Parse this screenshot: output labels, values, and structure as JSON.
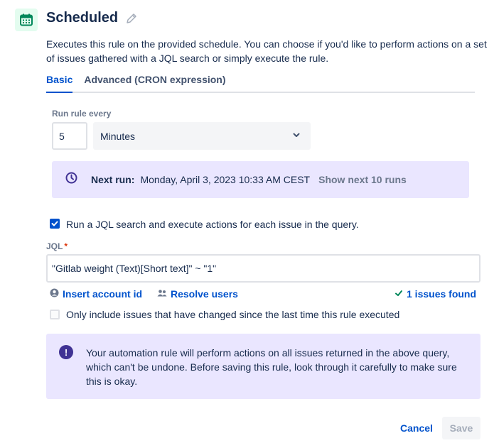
{
  "header": {
    "title": "Scheduled",
    "icon": "calendar-icon",
    "edit_icon": "pencil-icon",
    "icon_color": "#00875a"
  },
  "description": "Executes this rule on the provided schedule. You can choose if you'd like to perform actions on a set of issues gathered with a JQL search or simply execute the rule.",
  "tabs": [
    {
      "label": "Basic",
      "active": true
    },
    {
      "label": "Advanced (CRON expression)",
      "active": false
    }
  ],
  "schedule": {
    "run_every_label": "Run rule every",
    "interval_value": "5",
    "unit_selected": "Minutes",
    "next_run_label": "Next run:",
    "next_run_value": "Monday, April 3, 2023 10:33 AM CEST",
    "show_next_label": "Show next 10 runs"
  },
  "jql": {
    "checkbox_label": "Run a JQL search and execute actions for each issue in the query.",
    "checkbox_checked": true,
    "label": "JQL",
    "required_marker": "*",
    "value": "\"Gitlab weight (Text)[Short text]\" ~ \"1\"",
    "insert_account_label": "Insert account id",
    "resolve_users_label": "Resolve users",
    "issues_found_label": "1 issues found",
    "changed_checkbox_label": "Only include issues that have changed since the last time this rule executed",
    "changed_checkbox_checked": false
  },
  "info": {
    "text": "Your automation rule will perform actions on all issues returned in the above query, which can't be undone. Before saving this rule, look through it carefully to make sure this is okay."
  },
  "footer": {
    "cancel_label": "Cancel",
    "save_label": "Save"
  },
  "colors": {
    "primary": "#0052cc",
    "success": "#00875a",
    "discovery_bg": "#eae6ff",
    "discovery_icon": "#403294"
  }
}
